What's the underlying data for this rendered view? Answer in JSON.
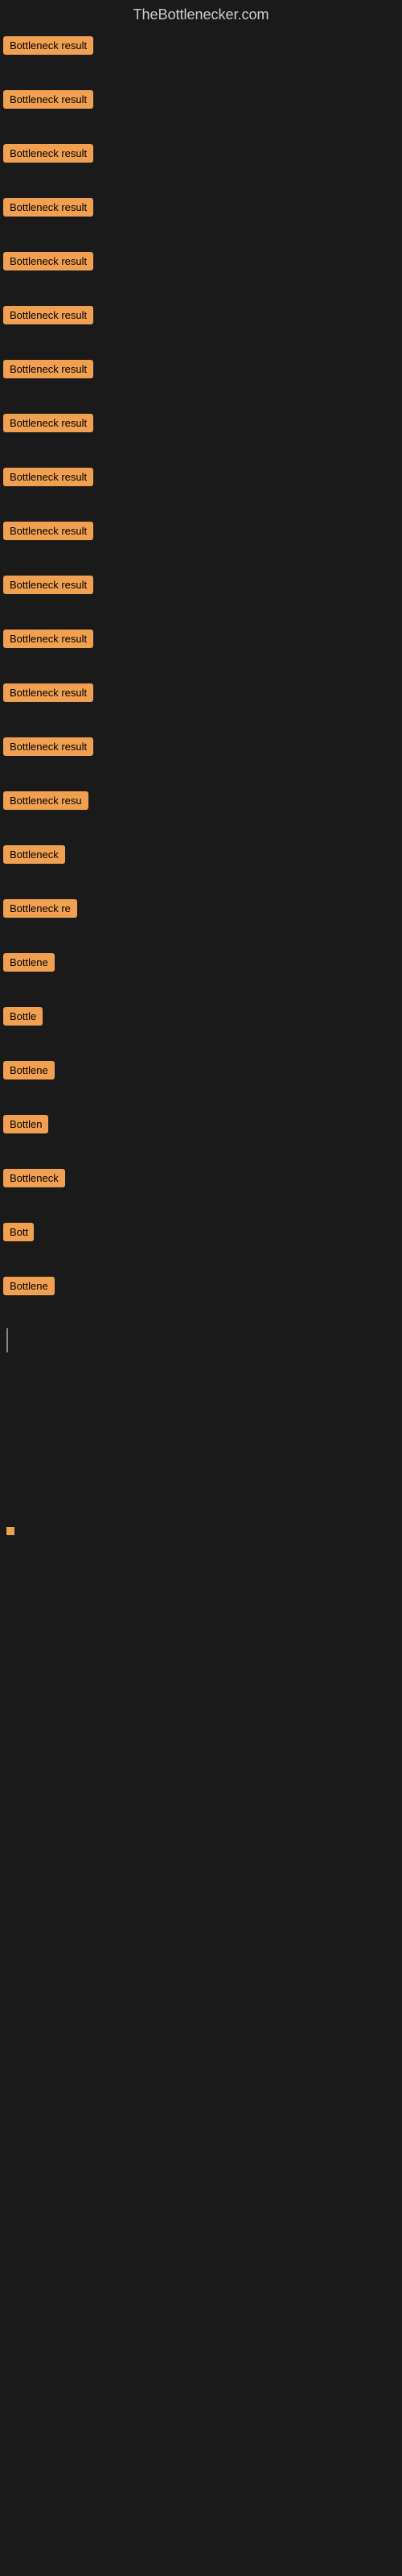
{
  "site": {
    "title": "TheBottlenecker.com"
  },
  "items": [
    {
      "label": "Bottleneck result",
      "width": 130
    },
    {
      "label": "Bottleneck result",
      "width": 130
    },
    {
      "label": "Bottleneck result",
      "width": 130
    },
    {
      "label": "Bottleneck result",
      "width": 130
    },
    {
      "label": "Bottleneck result",
      "width": 130
    },
    {
      "label": "Bottleneck result",
      "width": 130
    },
    {
      "label": "Bottleneck result",
      "width": 130
    },
    {
      "label": "Bottleneck result",
      "width": 130
    },
    {
      "label": "Bottleneck result",
      "width": 130
    },
    {
      "label": "Bottleneck result",
      "width": 130
    },
    {
      "label": "Bottleneck result",
      "width": 130
    },
    {
      "label": "Bottleneck result",
      "width": 130
    },
    {
      "label": "Bottleneck result",
      "width": 130
    },
    {
      "label": "Bottleneck result",
      "width": 130
    },
    {
      "label": "Bottleneck resu",
      "width": 115
    },
    {
      "label": "Bottleneck",
      "width": 78
    },
    {
      "label": "Bottleneck re",
      "width": 95
    },
    {
      "label": "Bottlene",
      "width": 65
    },
    {
      "label": "Bottle",
      "width": 50
    },
    {
      "label": "Bottlene",
      "width": 65
    },
    {
      "label": "Bottlen",
      "width": 60
    },
    {
      "label": "Bottleneck",
      "width": 78
    },
    {
      "label": "Bott",
      "width": 38
    },
    {
      "label": "Bottlene",
      "width": 65
    }
  ]
}
